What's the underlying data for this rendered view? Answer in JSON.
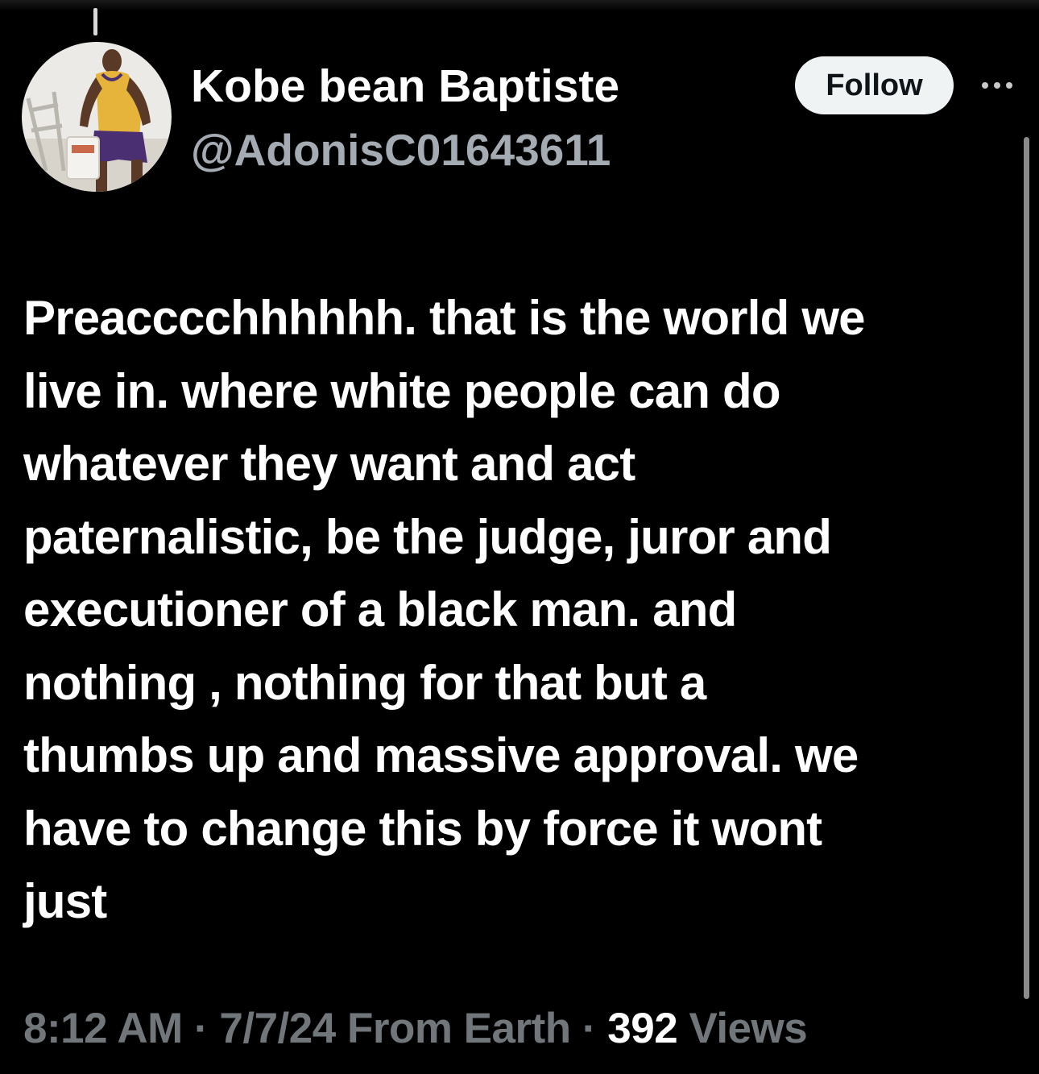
{
  "user": {
    "display_name": "Kobe bean Baptiste",
    "handle": "@AdonisC01643611",
    "avatar_icon": "profile-photo"
  },
  "actions": {
    "follow_label": "Follow",
    "more_icon": "more-options-icon"
  },
  "tweet": {
    "lines": [
      "Preacccchhhhhh. that is the world we",
      "live in. where white people can do",
      "whatever they want and act",
      "paternalistic, be the judge, juror and",
      "executioner of a black man. and",
      "nothing , nothing for that but a",
      "thumbs up and massive approval. we",
      "have to change this by force it wont",
      "just"
    ]
  },
  "meta": {
    "time": "8:12 AM",
    "sep1": " · ",
    "date": "7/7/24",
    "source": " From Earth",
    "sep2": " · ",
    "views_count": "392",
    "views_label": " Views"
  },
  "colors": {
    "background": "#000000",
    "text_primary": "#ffffff",
    "text_secondary": "#71767b",
    "follow_bg": "#eff3f4",
    "follow_text": "#0f1419"
  }
}
